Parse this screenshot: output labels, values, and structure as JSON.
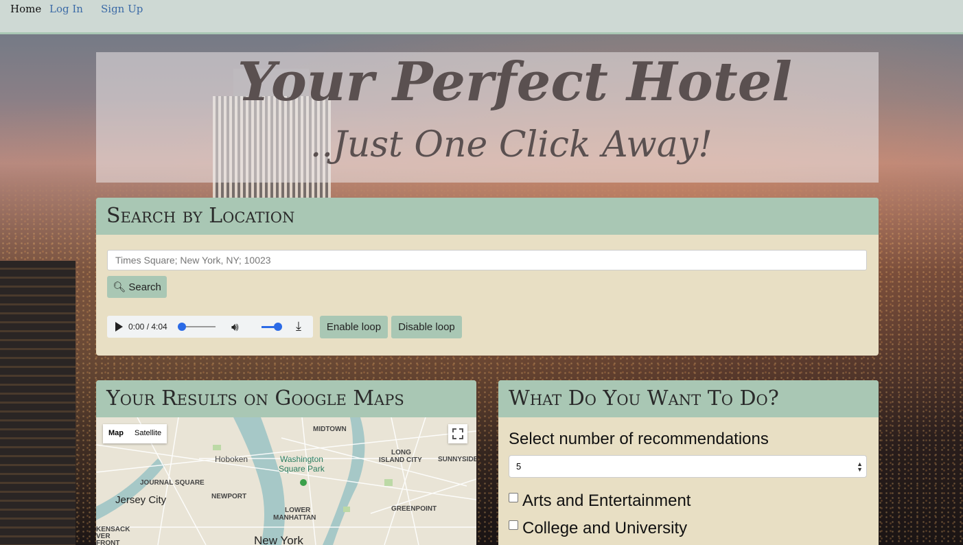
{
  "nav": {
    "home": "Home",
    "login": "Log In",
    "signup": "Sign Up"
  },
  "hero": {
    "title": "Your Perfect Hotel",
    "subtitle": "..Just One Click Away!"
  },
  "search": {
    "heading": "Search by Location",
    "placeholder": "Times Square; New York, NY; 10023",
    "button_label": "Search",
    "audio": {
      "time": "0:00 / 4:04",
      "progress": 0.0,
      "volume": 1.0
    },
    "enable_loop": "Enable loop",
    "disable_loop": "Disable loop"
  },
  "maps": {
    "heading": "Your Results on Google Maps",
    "toggle": {
      "map": "Map",
      "satellite": "Satellite"
    },
    "labels": {
      "midtown": "MIDTOWN",
      "hoboken": "Hoboken",
      "washington": "Washington",
      "square_park": "Square Park",
      "long_island": "LONG",
      "island_city": "ISLAND CITY",
      "sunnyside": "SUNNYSIDE",
      "journal_square": "JOURNAL SQUARE",
      "jersey_city": "Jersey City",
      "newport": "NEWPORT",
      "lower": "LOWER",
      "manhattan": "MANHATTAN",
      "greenpoint": "GREENPOINT",
      "kensack": "KENSACK",
      "ver": "VER",
      "front": "FRONT",
      "new_york": "New York"
    }
  },
  "todo": {
    "heading": "What Do You Want To Do?",
    "select_label": "Select number of recommendations",
    "select_value": "5",
    "categories": [
      "Arts and Entertainment",
      "College and University"
    ]
  }
}
